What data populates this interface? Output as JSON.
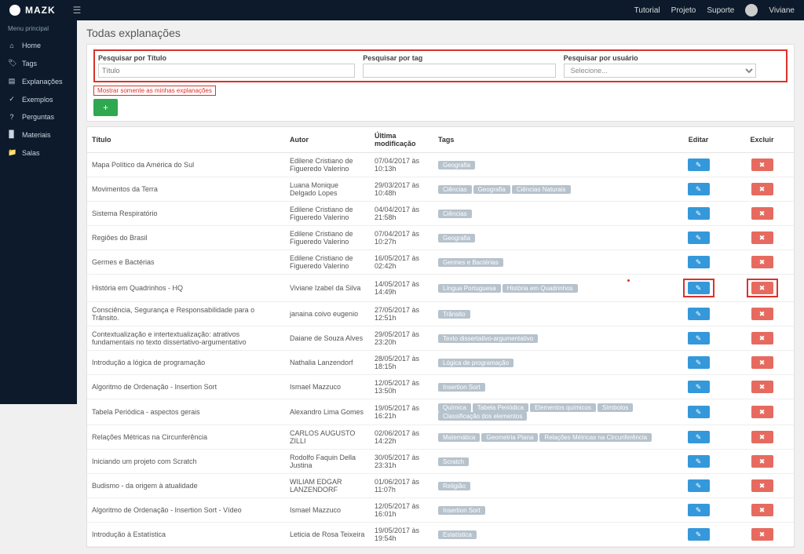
{
  "app": {
    "name": "MAZK"
  },
  "topnav": {
    "tutorial": "Tutorial",
    "project": "Projeto",
    "support": "Suporte",
    "user": "Viviane"
  },
  "sidebar": {
    "header": "Menu principal",
    "items": [
      {
        "icon": "home-icon",
        "glyph": "⌂",
        "label": "Home"
      },
      {
        "icon": "tag-icon",
        "glyph": "🏷",
        "label": "Tags"
      },
      {
        "icon": "book-icon",
        "glyph": "▤",
        "label": "Explanações"
      },
      {
        "icon": "check-icon",
        "glyph": "✓",
        "label": "Exemplos"
      },
      {
        "icon": "question-icon",
        "glyph": "?",
        "label": "Perguntas"
      },
      {
        "icon": "file-icon",
        "glyph": "▉",
        "label": "Materiais"
      },
      {
        "icon": "folder-icon",
        "glyph": "📁",
        "label": "Salas"
      }
    ]
  },
  "page": {
    "title": "Todas explanações",
    "filters": {
      "title_label": "Pesquisar por Título",
      "title_placeholder": "Título",
      "tag_label": "Pesquisar por tag",
      "user_label": "Pesquisar por usuário",
      "user_placeholder": "Selecione..."
    },
    "mine_link": "Mostrar somente as minhas explanações",
    "add_label": "+"
  },
  "table": {
    "headers": {
      "title": "Título",
      "author": "Autor",
      "modified": "Última modificação",
      "tags": "Tags",
      "edit": "Editar",
      "delete": "Excluir"
    },
    "rows": [
      {
        "title": "Mapa Político da América do Sul",
        "author": "Edilene Cristiano de Figueredo Valerino",
        "date": "07/04/2017 às 10:13h",
        "tags": [
          "Geografia"
        ],
        "hl": false
      },
      {
        "title": "Movimentos da Terra",
        "author": "Luana Monique Delgado Lopes",
        "date": "29/03/2017 às 10:48h",
        "tags": [
          "Ciências",
          "Geografia",
          "Ciências Naturais"
        ],
        "hl": false
      },
      {
        "title": "Sistema Respiratório",
        "author": "Edilene Cristiano de Figueredo Valerino",
        "date": "04/04/2017 às 21:58h",
        "tags": [
          "Ciências"
        ],
        "hl": false
      },
      {
        "title": "Regiões do Brasil",
        "author": "Edilene Cristiano de Figueredo Valerino",
        "date": "07/04/2017 às 10:27h",
        "tags": [
          "Geografia"
        ],
        "hl": false
      },
      {
        "title": "Germes e Bactérias",
        "author": "Edilene Cristiano de Figueredo Valerino",
        "date": "16/05/2017 às 02:42h",
        "tags": [
          "Germes e Bactérias"
        ],
        "hl": false
      },
      {
        "title": "História em Quadrinhos - HQ",
        "author": "Viviane Izabel da Silva",
        "date": "14/05/2017 às 14:49h",
        "tags": [
          "Língua Portuguesa",
          "História em Quadrinhos"
        ],
        "hl": true
      },
      {
        "title": "Consciência, Segurança e Responsabilidade para o Trânsito.",
        "author": "janaina coivo eugenio",
        "date": "27/05/2017 às 12:51h",
        "tags": [
          "Trânsito"
        ],
        "hl": false
      },
      {
        "title": "Contextualização e intertextualização: atrativos fundamentais no texto dissertativo-argumentativo",
        "author": "Daiane de Souza Alves",
        "date": "29/05/2017 às 23:20h",
        "tags": [
          "Texto dissertativo-argumentativo"
        ],
        "hl": false
      },
      {
        "title": "Introdução a lógica de programação",
        "author": "Nathalia Lanzendorf",
        "date": "28/05/2017 às 18:15h",
        "tags": [
          "Lógica de programação"
        ],
        "hl": false
      },
      {
        "title": "Algoritmo de Ordenação - Insertion Sort",
        "author": "Ismael Mazzuco",
        "date": "12/05/2017 às 13:50h",
        "tags": [
          "Insertion Sort"
        ],
        "hl": false
      },
      {
        "title": "Tabela Periódica - aspectos gerais",
        "author": "Alexandro Lima Gomes",
        "date": "19/05/2017 às 16:21h",
        "tags": [
          "Química",
          "Tabela Periódica",
          "Elementos químicos",
          "Símbolos",
          "Classificação dos elementos"
        ],
        "hl": false
      },
      {
        "title": "Relações Métricas na Circunferência",
        "author": "CARLOS AUGUSTO ZILLI",
        "date": "02/06/2017 às 14:22h",
        "tags": [
          "Matemática",
          "Geometria Plana",
          "Relações Métricas na Circunferência"
        ],
        "hl": false
      },
      {
        "title": "Iniciando um projeto com Scratch",
        "author": "Rodolfo Faquin Della Justina",
        "date": "30/05/2017 às 23:31h",
        "tags": [
          "Scratch"
        ],
        "hl": false
      },
      {
        "title": "Budismo - da origem à atualidade",
        "author": "WILIAM EDGAR LANZENDORF",
        "date": "01/06/2017 às 11:07h",
        "tags": [
          "Religião"
        ],
        "hl": false
      },
      {
        "title": "Algoritmo de Ordenação - Insertion Sort - Vídeo",
        "author": "Ismael Mazzuco",
        "date": "12/05/2017 às 16:01h",
        "tags": [
          "Insertion Sort"
        ],
        "hl": false
      },
      {
        "title": "Introdução à Estatística",
        "author": "Leticia de Rosa Teixeira",
        "date": "19/05/2017 às 19:54h",
        "tags": [
          "Estatística"
        ],
        "hl": false
      }
    ]
  }
}
